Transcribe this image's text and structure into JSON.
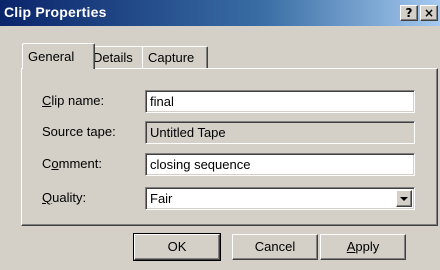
{
  "window": {
    "title": "Clip Properties",
    "help_label": "?",
    "close_label": "×"
  },
  "tabs": [
    {
      "label": "General",
      "active": true
    },
    {
      "label": "Details",
      "active": false
    },
    {
      "label": "Capture",
      "active": false
    }
  ],
  "form": {
    "clip_name": {
      "label_mnemonic": "C",
      "label_rest": "lip name:",
      "value": "final"
    },
    "source_tape": {
      "label": "Source tape:",
      "value": "Untitled Tape"
    },
    "comment": {
      "label_pre": "C",
      "label_mnemonic": "o",
      "label_rest": "mment:",
      "value": "closing sequence"
    },
    "quality": {
      "label_mnemonic": "Q",
      "label_rest": "uality:",
      "value": "Fair"
    }
  },
  "buttons": {
    "ok": "OK",
    "cancel": "Cancel",
    "apply_mnemonic": "A",
    "apply_rest": "pply"
  },
  "colors": {
    "title_gradient_start": "#0a246a",
    "title_gradient_end": "#a6caf0",
    "face": "#d4d0c8"
  }
}
